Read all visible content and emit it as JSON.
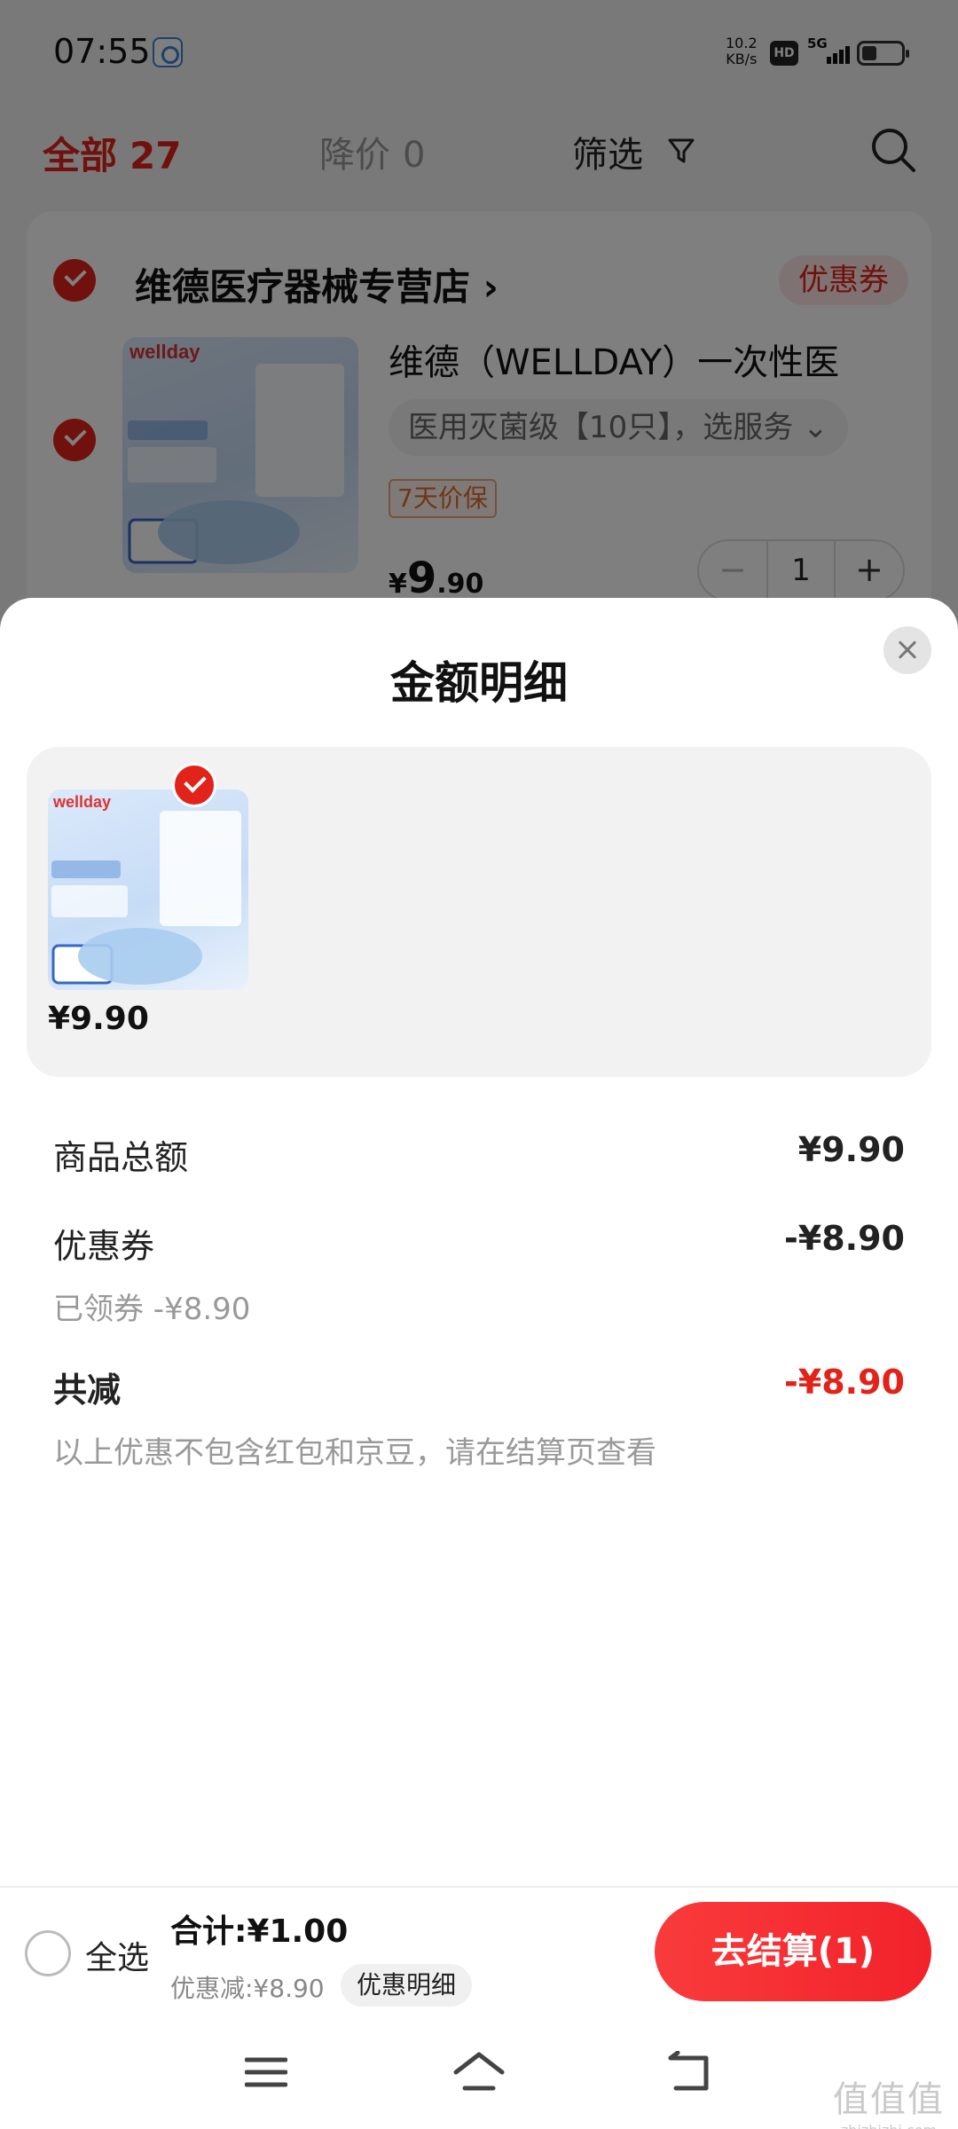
{
  "status_bar": {
    "time": "07:55",
    "net_speed_value": "10.2",
    "net_speed_unit": "KB/s",
    "hd_badge": "HD",
    "signal_label": "5G"
  },
  "filter_bar": {
    "tab_all_label": "全部",
    "tab_all_count": "27",
    "tab_price_drop_label": "降价",
    "tab_price_drop_count": "0",
    "filter_label": "筛选"
  },
  "shop": {
    "name": "维德医疗器械专营店",
    "coupon_label": "优惠券",
    "product": {
      "title": "维德（WELLDAY）一次性医",
      "spec": "医用灭菌级【10只】，选服务",
      "tag": "7天价保",
      "price_symbol": "¥",
      "price_int": "9",
      "price_dec": ".90",
      "quantity": "1",
      "qty_minus": "−",
      "qty_plus": "+"
    }
  },
  "sheet": {
    "title": "金额明细",
    "item_price": "¥9.90",
    "rows": {
      "goods_total_label": "商品总额",
      "goods_total_value": "¥9.90",
      "coupon_label": "优惠券",
      "coupon_value": "-¥8.90",
      "coupon_sub": "已领券 -¥8.90",
      "reduce_label": "共减",
      "reduce_value": "-¥8.90",
      "note": "以上优惠不包含红包和京豆，请在结算页查看"
    }
  },
  "checkout": {
    "select_all_label": "全选",
    "sum_text": "合计:¥1.00",
    "saved_text": "优惠减:¥8.90",
    "detail_link": "优惠明细",
    "checkout_button": "去结算(1)"
  },
  "watermark": {
    "logo": "值值值",
    "url": "zhizhizhi.com"
  },
  "colors": {
    "brand_red": "#e2231a",
    "sheet_bg": "#ffffff",
    "panel_bg": "#f2f2f2"
  }
}
